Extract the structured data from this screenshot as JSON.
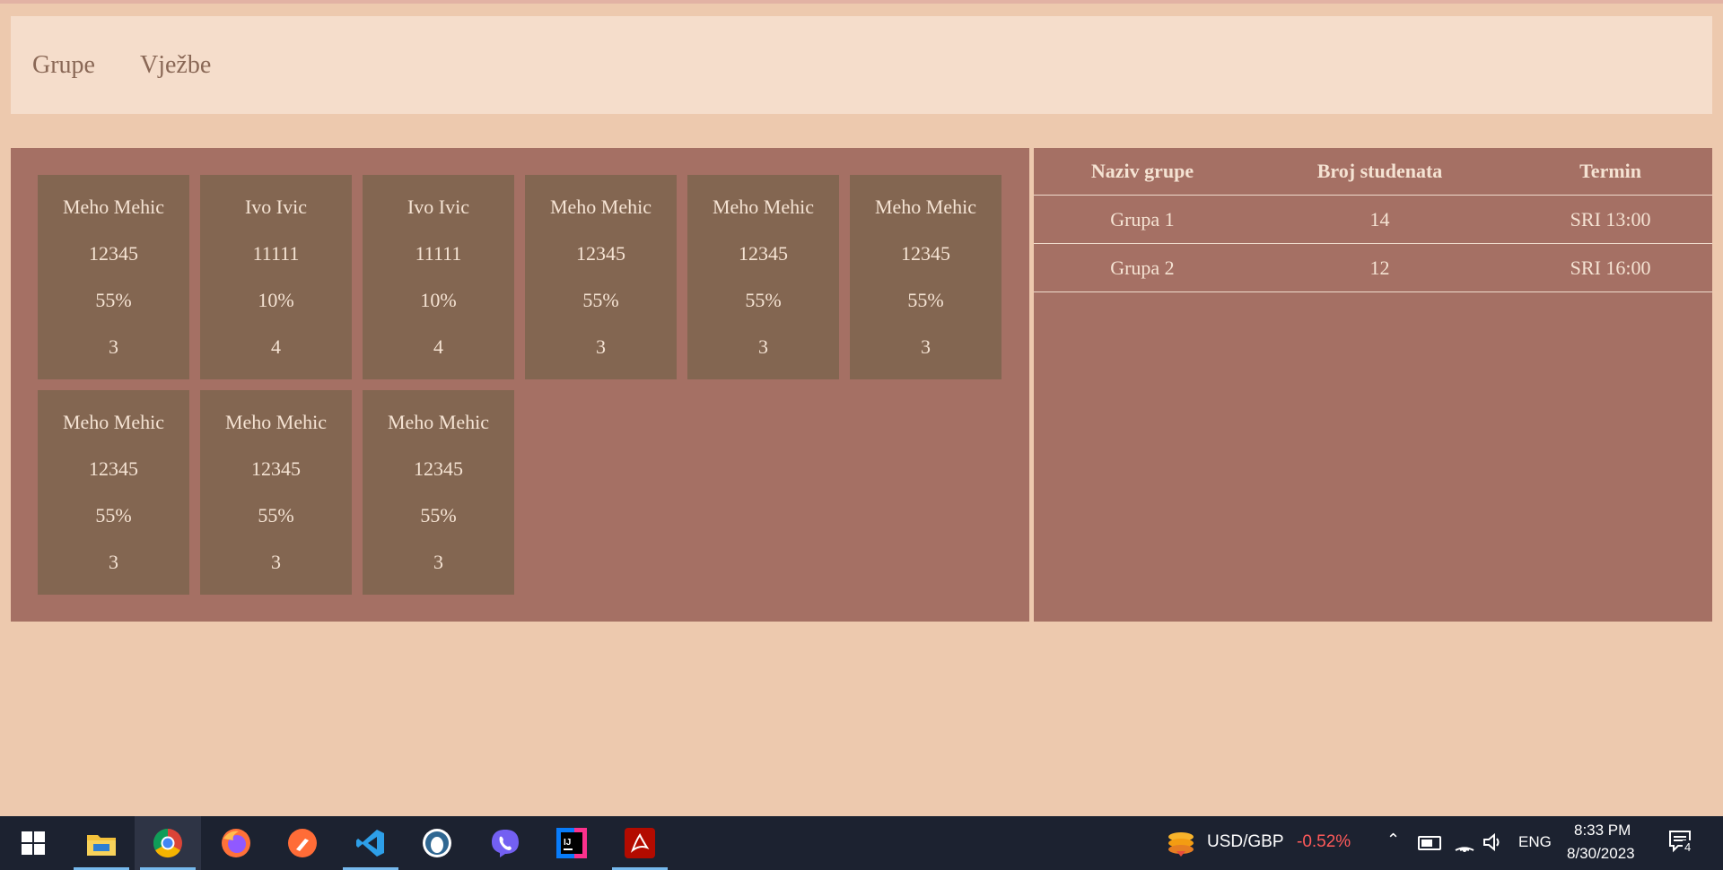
{
  "nav": {
    "items": [
      "Grupe",
      "Vježbe"
    ]
  },
  "students": [
    {
      "name": "Meho Mehic",
      "index": "12345",
      "percent": "55%",
      "count": "3"
    },
    {
      "name": "Ivo Ivic",
      "index": "11111",
      "percent": "10%",
      "count": "4"
    },
    {
      "name": "Ivo Ivic",
      "index": "11111",
      "percent": "10%",
      "count": "4"
    },
    {
      "name": "Meho Mehic",
      "index": "12345",
      "percent": "55%",
      "count": "3"
    },
    {
      "name": "Meho Mehic",
      "index": "12345",
      "percent": "55%",
      "count": "3"
    },
    {
      "name": "Meho Mehic",
      "index": "12345",
      "percent": "55%",
      "count": "3"
    },
    {
      "name": "Meho Mehic",
      "index": "12345",
      "percent": "55%",
      "count": "3"
    },
    {
      "name": "Meho Mehic",
      "index": "12345",
      "percent": "55%",
      "count": "3"
    },
    {
      "name": "Meho Mehic",
      "index": "12345",
      "percent": "55%",
      "count": "3"
    }
  ],
  "groups_table": {
    "headers": [
      "Naziv grupe",
      "Broj studenata",
      "Termin"
    ],
    "rows": [
      [
        "Grupa 1",
        "14",
        "SRI 13:00"
      ],
      [
        "Grupa 2",
        "12",
        "SRI 16:00"
      ]
    ]
  },
  "taskbar": {
    "apps": [
      {
        "icon": "windows-start-icon"
      },
      {
        "icon": "file-explorer-icon"
      },
      {
        "icon": "chrome-icon"
      },
      {
        "icon": "firefox-icon"
      },
      {
        "icon": "postman-icon"
      },
      {
        "icon": "vscode-icon"
      },
      {
        "icon": "pgadmin-icon"
      },
      {
        "icon": "viber-icon"
      },
      {
        "icon": "intellij-icon"
      },
      {
        "icon": "acrobat-icon"
      }
    ],
    "ticker_label": "USD/GBP",
    "ticker_change": "-0.52%",
    "ticker_change_color": "#ff5a5a",
    "language": "ENG",
    "time": "8:33 PM",
    "date": "8/30/2023",
    "notification_count": "4"
  },
  "colors": {
    "page_bg": "#edc9ae",
    "navbar_bg": "#f5ddcb",
    "panel_bg": "#a57064",
    "card_bg": "#836651",
    "taskbar_bg": "#1c2230"
  }
}
